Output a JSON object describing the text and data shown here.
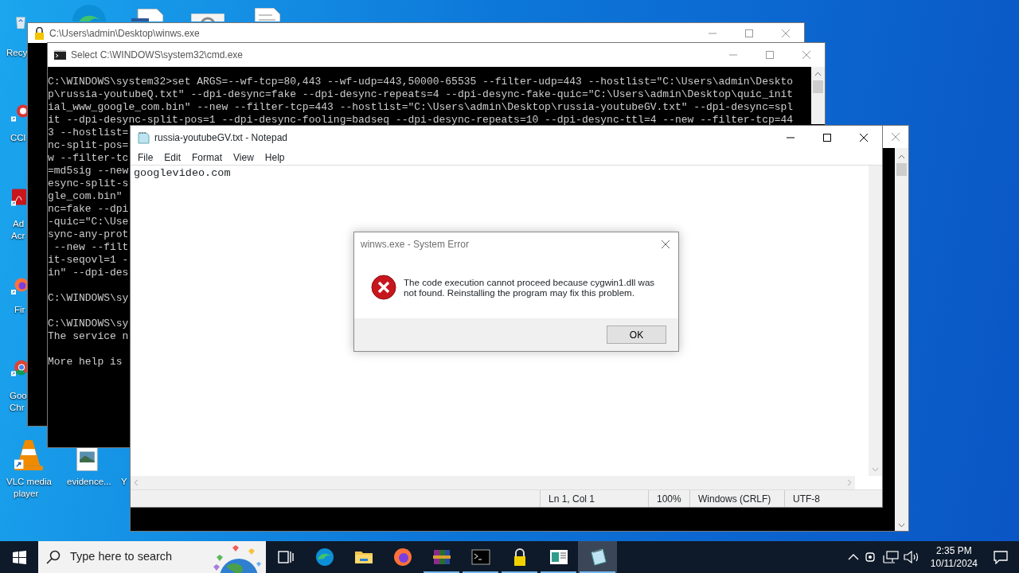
{
  "desktop_icons": [
    {
      "kind": "recycle-bin",
      "label": [
        "Recy"
      ]
    },
    {
      "kind": "ccleaner",
      "label": [
        "CCl"
      ]
    },
    {
      "kind": "acrobat",
      "label": [
        "Ad",
        "Acr"
      ]
    },
    {
      "kind": "firefox",
      "label": [
        "Fir"
      ]
    },
    {
      "kind": "chrome",
      "label": [
        "Goo",
        "Chr"
      ]
    },
    {
      "kind": "vlc",
      "label": [
        "VLC media",
        "player"
      ]
    },
    {
      "kind": "image-file",
      "label": [
        "evidence..."
      ]
    },
    {
      "label": [
        "Y"
      ]
    },
    {
      "kind": "edge"
    },
    {
      "kind": "word-doc"
    },
    {
      "kind": "settings-file"
    },
    {
      "kind": "text-doc"
    }
  ],
  "winws_window": {
    "title": "C:\\Users\\admin\\Desktop\\winws.exe"
  },
  "cmd_window": {
    "title": "Select C:\\WINDOWS\\system32\\cmd.exe",
    "blocks": [
      [
        "C:\\WINDOWS\\system32>set ARGS=--wf-tcp=80,443 --wf-udp=443,50000-65535 --filter-udp=443 --hostlist=\"C:\\Users\\admin\\Deskto",
        "p\\russia-youtubeQ.txt\" --dpi-desync=fake --dpi-desync-repeats=4 --dpi-desync-fake-quic=\"C:\\Users\\admin\\Desktop\\quic_init",
        "ial_www_google_com.bin\" --new --filter-tcp=443 --hostlist=\"C:\\Users\\admin\\Desktop\\russia-youtubeGV.txt\" --dpi-desync=spl",
        "it --dpi-desync-split-pos=1 --dpi-desync-fooling=badseq --dpi-desync-repeats=10 --dpi-desync-ttl=4 --new --filter-tcp=44",
        "3 --hostlist=",
        "nc-split-pos=",
        "w --filter-tc",
        "=md5sig --new",
        "esync-split-s",
        "gle_com.bin\"",
        "nc=fake --dpi",
        "-quic=\"C:\\Use",
        "sync-any-prot",
        " --new --filt",
        "it-seqovl=1 -",
        "in\" --dpi-des"
      ],
      [
        "C:\\WINDOWS\\sy"
      ],
      [
        "C:\\WINDOWS\\sy",
        "The service n"
      ],
      [
        "More help is"
      ]
    ]
  },
  "notepad": {
    "title": "russia-youtubeGV.txt - Notepad",
    "menu": [
      "File",
      "Edit",
      "Format",
      "View",
      "Help"
    ],
    "content": "googlevideo.com",
    "status": [
      "Ln 1, Col 1",
      "100%",
      "Windows (CRLF)",
      "UTF-8"
    ]
  },
  "error_dialog": {
    "title": "winws.exe - System Error",
    "message": "The code execution cannot proceed because cygwin1.dll was not found. Reinstalling the program may fix this problem.",
    "button": "OK"
  },
  "taskbar": {
    "search": {
      "placeholder": "Type here to search"
    },
    "apps": [
      {
        "kind": "task-view",
        "running": false,
        "selected": false
      },
      {
        "kind": "edge",
        "running": false,
        "selected": false
      },
      {
        "kind": "folder",
        "running": false,
        "selected": false
      },
      {
        "kind": "firefox",
        "running": false,
        "selected": false
      },
      {
        "kind": "winrar",
        "running": true,
        "selected": false
      },
      {
        "kind": "terminal",
        "running": true,
        "selected": false
      },
      {
        "kind": "lock",
        "running": true,
        "selected": false
      },
      {
        "kind": "app-window",
        "running": true,
        "selected": false
      },
      {
        "kind": "notepad",
        "running": true,
        "selected": true
      }
    ],
    "time": "2:35 PM",
    "date": "10/11/2024"
  }
}
